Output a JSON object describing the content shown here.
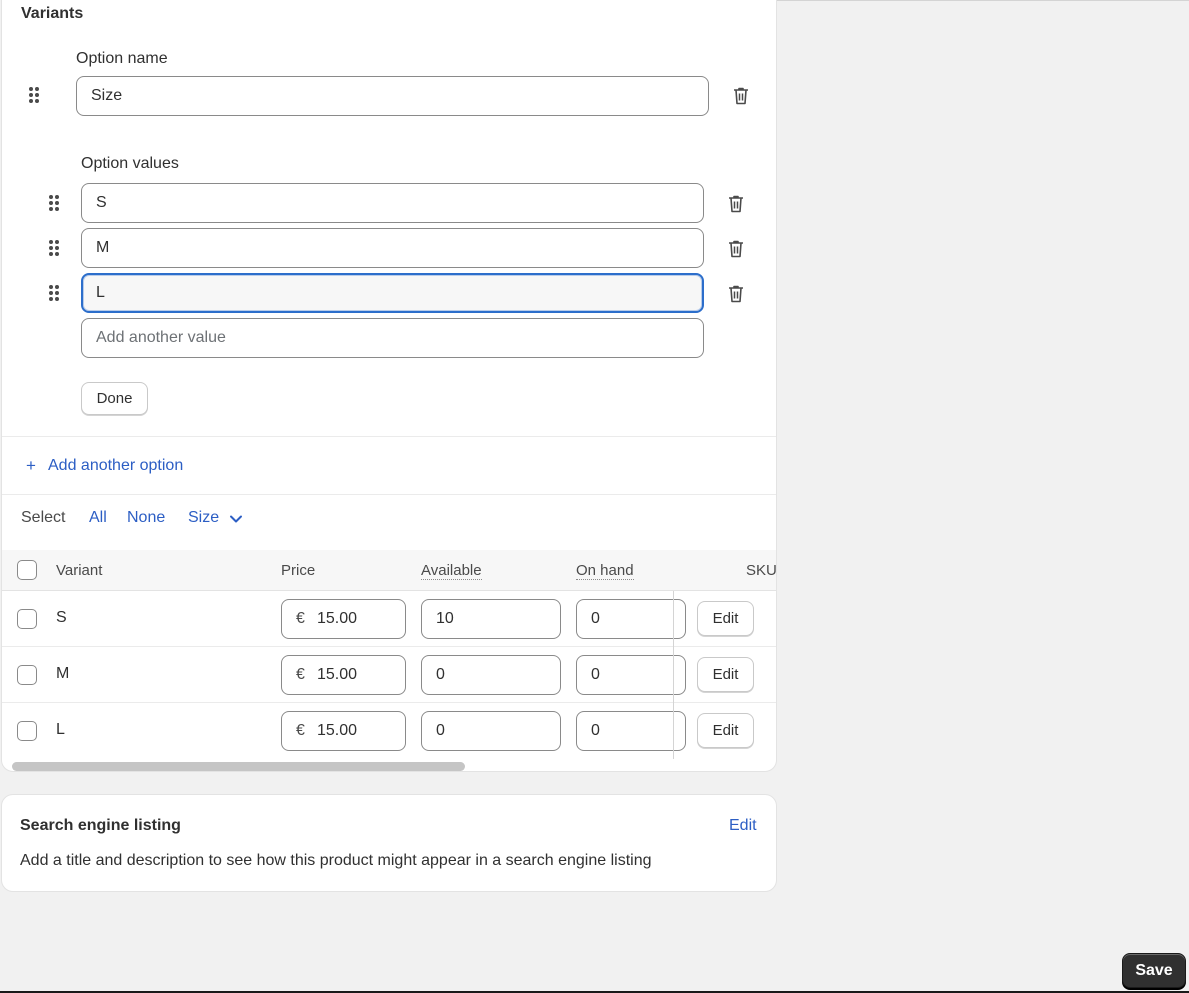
{
  "variants_card": {
    "title": "Variants",
    "option_name_label": "Option name",
    "option_name_value": "Size",
    "option_values_label": "Option values",
    "option_values": [
      "S",
      "M",
      "L"
    ],
    "add_value_placeholder": "Add another value",
    "done_label": "Done",
    "add_option_label": "Add another option",
    "add_option_icon": "+"
  },
  "select_bar": {
    "label": "Select",
    "all": "All",
    "none": "None",
    "size": "Size"
  },
  "table": {
    "headers": {
      "variant": "Variant",
      "price": "Price",
      "available": "Available",
      "on_hand": "On hand",
      "sku": "SKU"
    },
    "currency_symbol": "€",
    "edit_label": "Edit",
    "rows": [
      {
        "name": "S",
        "price": "15.00",
        "available": "10",
        "on_hand": "0"
      },
      {
        "name": "M",
        "price": "15.00",
        "available": "0",
        "on_hand": "0"
      },
      {
        "name": "L",
        "price": "15.00",
        "available": "0",
        "on_hand": "0"
      }
    ]
  },
  "seo_card": {
    "title": "Search engine listing",
    "edit_label": "Edit",
    "description": "Add a title and description to see how this product might appear in a search engine listing"
  },
  "save_label": "Save",
  "colors": {
    "link": "#2c5ec4",
    "focus": "#2c6ecb",
    "primary_button": "#303030"
  }
}
